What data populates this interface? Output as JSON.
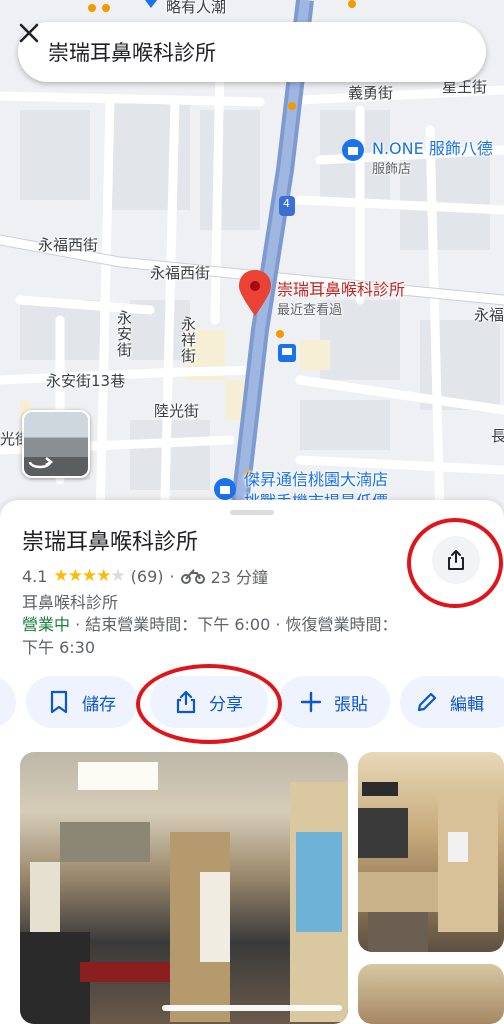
{
  "map": {
    "labels": {
      "top_road": "略有人潮",
      "yiyong": "義勇街",
      "xingwang": "星王街",
      "store_name": "N.ONE 服飾八德",
      "store_type": "服飾店",
      "road_number": "4",
      "yongfu_west_1": "永福西街",
      "yongfu_west_2": "永福西街",
      "yongan": "永安街",
      "yongxiang": "永祥街",
      "yongan13": "永安街13巷",
      "luguang": "陸光街",
      "left_edge": "光街",
      "right_edge_1": "永福",
      "right_edge_2": "長",
      "poi_name": "崇瑞耳鼻喉科診所",
      "poi_recent": "最近查看過",
      "bottom_store_1": "傑昇通信桃園大湳店",
      "bottom_store_2": "挑戰手機市場最低價"
    }
  },
  "search": {
    "query": "崇瑞耳鼻喉科診所"
  },
  "place": {
    "title": "崇瑞耳鼻喉科診所",
    "rating": "4.1",
    "stars": 4,
    "reviews": "(69)",
    "dot": "·",
    "travel_time": "23 分鐘",
    "category": "耳鼻喉科診所",
    "status_open": "營業中",
    "hours_detail": " · 結束營業時間：下午 6:00 · 恢復營業時間：下午 6:30"
  },
  "actions": {
    "save": "儲存",
    "share": "分享",
    "paste": "張貼",
    "edit": "編輯"
  },
  "colors": {
    "accent": "#0b57d0",
    "chip_bg": "#eef3fd",
    "open_green": "#188038",
    "star": "#fbbc04",
    "annotation_red": "#e0151b",
    "pin_red": "#ea4335",
    "road_blue": "#7e9bd0"
  }
}
